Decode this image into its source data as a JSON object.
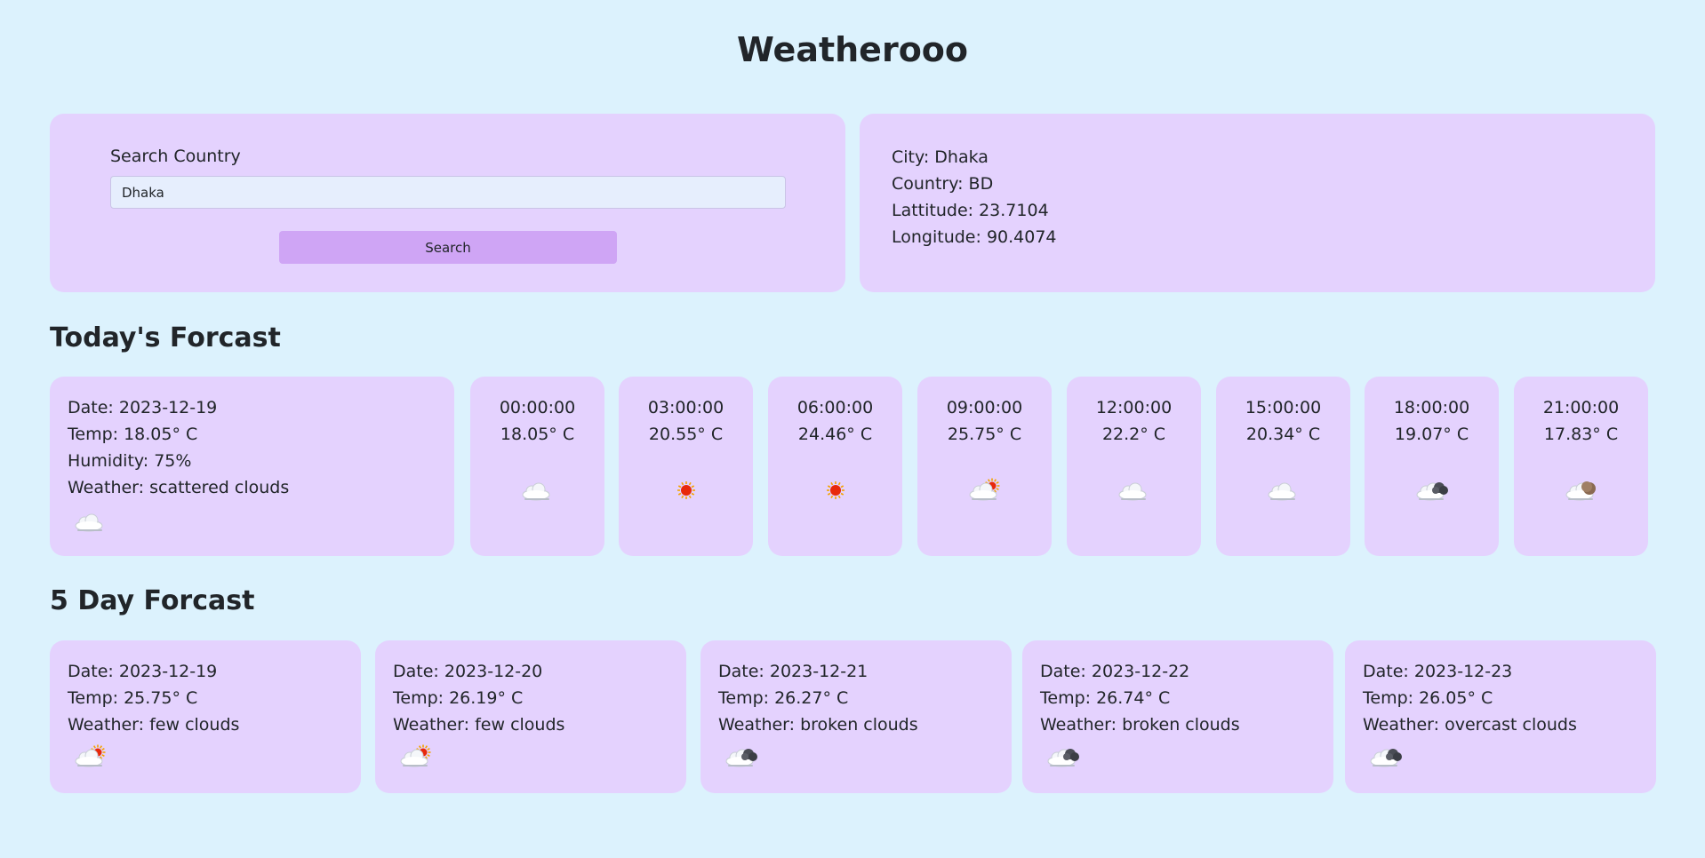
{
  "app_title": "Weatherooo",
  "search": {
    "label": "Search Country",
    "value": "Dhaka",
    "placeholder": "",
    "button_label": "Search"
  },
  "location": {
    "city": "City: Dhaka",
    "country": "Country: BD",
    "latitude": "Lattitude: 23.7104",
    "longitude": "Longitude: 90.4074"
  },
  "today": {
    "title": "Today's Forcast",
    "date": "Date: 2023-12-19",
    "temp": "Temp: 18.05° C",
    "humidity": "Humidity: 75%",
    "weather": "Weather: scattered clouds",
    "icon": "cloud-icon",
    "hourly": [
      {
        "time": "00:00:00",
        "temp": "18.05° C",
        "icon": "cloud-icon"
      },
      {
        "time": "03:00:00",
        "temp": "20.55° C",
        "icon": "sun-icon"
      },
      {
        "time": "06:00:00",
        "temp": "24.46° C",
        "icon": "sun-icon"
      },
      {
        "time": "09:00:00",
        "temp": "25.75° C",
        "icon": "cloud-sun-icon"
      },
      {
        "time": "12:00:00",
        "temp": "22.2° C",
        "icon": "cloud-icon"
      },
      {
        "time": "15:00:00",
        "temp": "20.34° C",
        "icon": "cloud-icon"
      },
      {
        "time": "18:00:00",
        "temp": "19.07° C",
        "icon": "dark-clouds-icon"
      },
      {
        "time": "21:00:00",
        "temp": "17.83° C",
        "icon": "cloud-moon-icon"
      }
    ]
  },
  "five_day": {
    "title": "5 Day Forcast",
    "days": [
      {
        "date": "Date: 2023-12-19",
        "temp": "Temp: 25.75° C",
        "weather": "Weather: few clouds",
        "icon": "cloud-sun-icon"
      },
      {
        "date": "Date: 2023-12-20",
        "temp": "Temp: 26.19° C",
        "weather": "Weather: few clouds",
        "icon": "cloud-sun-icon"
      },
      {
        "date": "Date: 2023-12-21",
        "temp": "Temp: 26.27° C",
        "weather": "Weather: broken clouds",
        "icon": "dark-clouds-icon"
      },
      {
        "date": "Date: 2023-12-22",
        "temp": "Temp: 26.74° C",
        "weather": "Weather: broken clouds",
        "icon": "dark-clouds-icon"
      },
      {
        "date": "Date: 2023-12-23",
        "temp": "Temp: 26.05° C",
        "weather": "Weather: overcast clouds",
        "icon": "dark-clouds-icon"
      }
    ]
  },
  "colors": {
    "page_background": "#dcf2fd",
    "card_background": "#e4d2fe",
    "button_background": "#cfa5f5",
    "input_background": "#e6eefd"
  }
}
